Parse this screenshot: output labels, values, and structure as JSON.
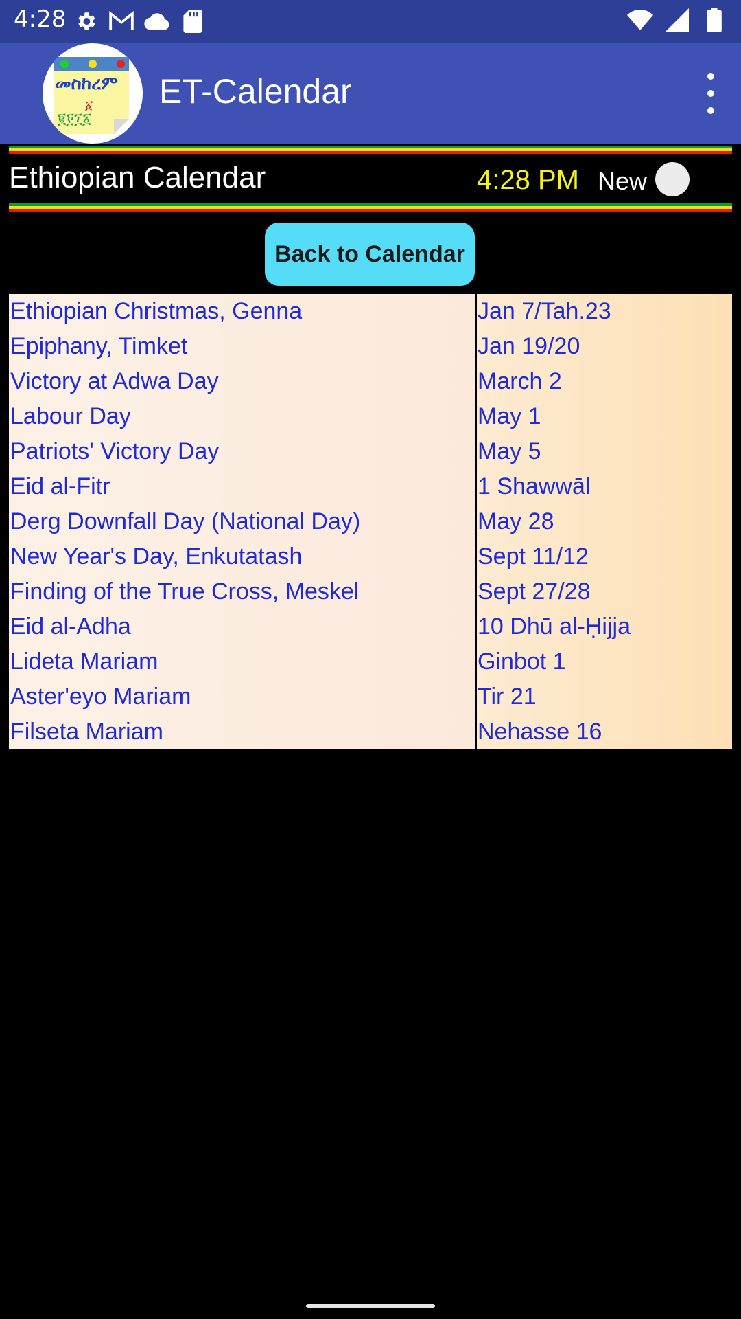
{
  "status_bar": {
    "time": "4:28",
    "icons_left": [
      "gear-icon",
      "gmail-icon",
      "cloud-icon",
      "sd-card-icon"
    ],
    "icons_right": [
      "wifi-icon",
      "signal-icon",
      "battery-icon"
    ]
  },
  "app_bar": {
    "title": "ET-Calendar",
    "logo_text_top": "መስከረም",
    "logo_text_mid": "፩",
    "logo_text_bottom": "፪፻፲፩"
  },
  "header": {
    "title": "Ethiopian Calendar",
    "time": "4:28 PM",
    "new_label": "New"
  },
  "back_button": {
    "label": "Back to Calendar"
  },
  "holidays": [
    {
      "name": "Ethiopian Christmas, Genna",
      "date": "Jan 7/Tah.23"
    },
    {
      "name": "Epiphany, Timket",
      "date": "Jan 19/20"
    },
    {
      "name": "Victory at Adwa Day",
      "date": "March 2"
    },
    {
      "name": "Labour Day",
      "date": "May 1"
    },
    {
      "name": "Patriots' Victory Day",
      "date": "May 5"
    },
    {
      "name": "Eid al-Fitr",
      "date": "1 Shawwāl"
    },
    {
      "name": "Derg Downfall Day (National Day)",
      "date": "May 28"
    },
    {
      "name": "New Year's Day, Enkutatash",
      "date": "Sept 11/12"
    },
    {
      "name": "Finding of the True Cross, Meskel",
      "date": "Sept 27/28"
    },
    {
      "name": "Eid al-Adha",
      "date": "10 Dhū al-Ḥijja"
    },
    {
      "name": "Lideta Mariam",
      "date": "Ginbot 1"
    },
    {
      "name": "Aster'eyo Mariam",
      "date": "Tir 21"
    },
    {
      "name": "Filseta Mariam",
      "date": "Nehasse 16"
    }
  ],
  "colors": {
    "status_bar": "#2d3f96",
    "app_bar": "#3f51b5",
    "flag_green": "#0a9a3a",
    "flag_yellow": "#f2e205",
    "flag_red": "#e8171c",
    "time_yellow": "#f3f31b",
    "button_cyan": "#55dcf6",
    "holiday_text": "#1f2bd6"
  }
}
